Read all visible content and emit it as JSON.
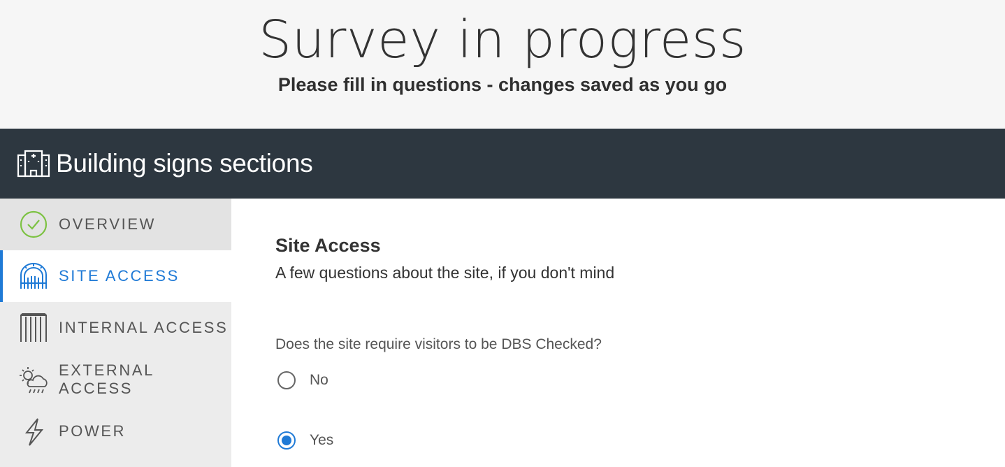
{
  "header": {
    "title": "Survey in progress",
    "subtitle": "Please fill in questions - changes saved as you go"
  },
  "section_bar": {
    "icon": "building-icon",
    "title": "Building signs sections"
  },
  "sidebar": {
    "items": [
      {
        "label": "OVERVIEW",
        "icon": "check-circle-icon",
        "state": "complete"
      },
      {
        "label": "SITE ACCESS",
        "icon": "gate-icon",
        "state": "active"
      },
      {
        "label": "INTERNAL ACCESS",
        "icon": "door-bars-icon",
        "state": "default"
      },
      {
        "label": "EXTERNAL ACCESS",
        "icon": "weather-icon",
        "state": "default"
      },
      {
        "label": "POWER",
        "icon": "lightning-icon",
        "state": "default"
      }
    ]
  },
  "main": {
    "section_title": "Site Access",
    "section_description": "A few questions about the site, if you don't mind",
    "question": "Does the site require visitors to be DBS Checked?",
    "options": [
      {
        "label": "No",
        "selected": false
      },
      {
        "label": "Yes",
        "selected": true
      }
    ]
  },
  "colors": {
    "accent": "#1f7ad6",
    "dark_bar": "#2d3740",
    "check_green": "#7dc243"
  }
}
